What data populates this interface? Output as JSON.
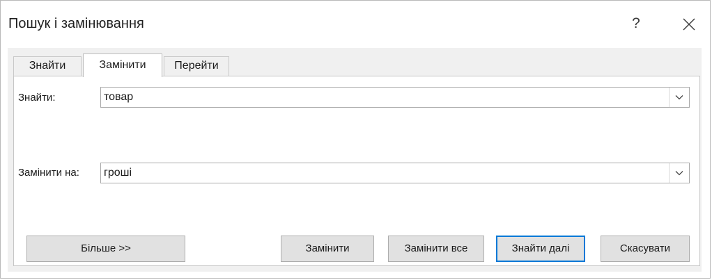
{
  "window": {
    "title": "Пошук і замінювання",
    "help_label": "?"
  },
  "tabs": [
    {
      "label": "Знайти",
      "active": false
    },
    {
      "label": "Замінити",
      "active": true
    },
    {
      "label": "Перейти",
      "active": false
    }
  ],
  "find": {
    "label": "Знайти:",
    "value": "товар"
  },
  "replace": {
    "label": "Замінити на:",
    "value": "гроші"
  },
  "buttons": {
    "more": "Більше >>",
    "replace": "Замінити",
    "replace_all": "Замінити все",
    "find_next": "Знайти далі",
    "cancel": "Скасувати"
  },
  "icons": {
    "help": "question-mark-icon",
    "close": "close-icon",
    "dropdown": "chevron-down-icon"
  },
  "colors": {
    "default_button_border": "#0078d7",
    "button_face": "#e1e1e1",
    "dialog_background": "#f0f0f0"
  }
}
